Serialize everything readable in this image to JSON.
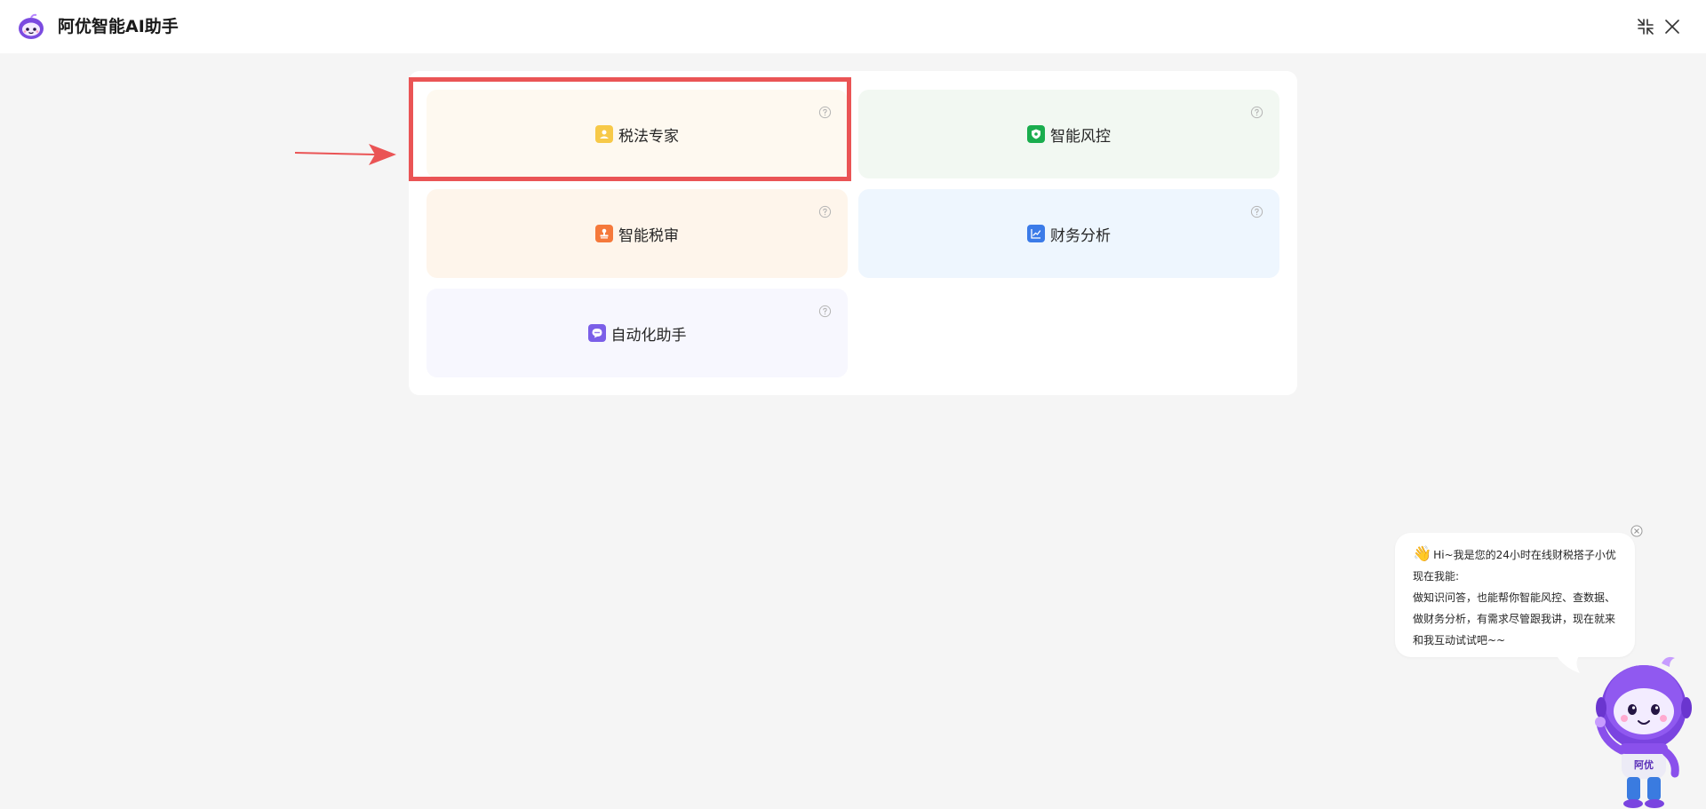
{
  "header": {
    "title": "阿优智能AI助手",
    "shrink_icon": "shrink-icon",
    "close_icon": "close-icon"
  },
  "cards": [
    {
      "label": "税法专家",
      "icon": "user-badge-icon",
      "icon_color": "#f7c948",
      "bg": "#fef9f0"
    },
    {
      "label": "智能风控",
      "icon": "shield-icon",
      "icon_color": "#1aad4e",
      "bg": "#f2f8f2"
    },
    {
      "label": "智能税审",
      "icon": "stamp-icon",
      "icon_color": "#f5793b",
      "bg": "#fef5eb"
    },
    {
      "label": "财务分析",
      "icon": "chart-icon",
      "icon_color": "#3b7be8",
      "bg": "#eef6fe"
    },
    {
      "label": "自动化助手",
      "icon": "chat-bot-icon",
      "icon_color": "#7b5fe8",
      "bg": "#f7f7fe"
    }
  ],
  "annotation": {
    "highlight_color": "#ea5455"
  },
  "assistant_bubble": {
    "line1": "Hi~我是您的24小时在线财税搭子小优",
    "line2": "现在我能:",
    "line3": "做知识问答，也能帮你智能风控、查数据、",
    "line4": "做财务分析，有需求尽管跟我讲，现在就来",
    "line5": "和我互动试试吧~~"
  },
  "mascot": {
    "badge_text": "阿优"
  }
}
